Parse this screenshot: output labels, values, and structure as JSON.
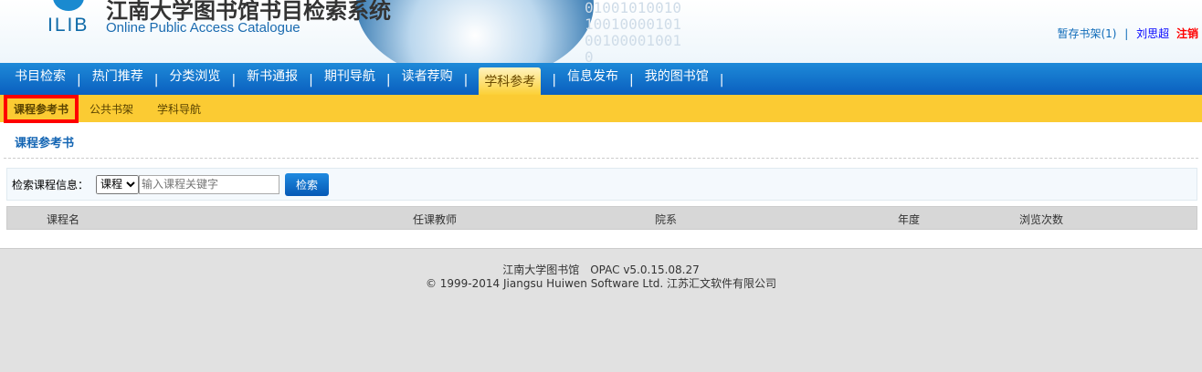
{
  "header": {
    "logo": "ILIB",
    "title": "江南大学图书馆书目检索系统",
    "subtitle": "Online Public Access Catalogue",
    "digits": "0100101001010010000101001000010010"
  },
  "userbar": {
    "shelf": "暂存书架(1)",
    "sep": "|",
    "user": "刘思超",
    "logout": "注销"
  },
  "nav": [
    "书目检索",
    "热门推荐",
    "分类浏览",
    "新书通报",
    "期刊导航",
    "读者荐购",
    "学科参考",
    "信息发布",
    "我的图书馆"
  ],
  "nav_active": 6,
  "subnav": [
    "课程参考书",
    "公共书架",
    "学科导航"
  ],
  "page_title": "课程参考书",
  "search": {
    "label": "检索课程信息：",
    "select": "课程",
    "placeholder": "输入课程关键字",
    "button": "检索"
  },
  "table": {
    "headers": [
      "课程名",
      "任课教师",
      "院系",
      "年度",
      "浏览次数"
    ]
  },
  "footer": {
    "line1": "江南大学图书馆　OPAC v5.0.15.08.27",
    "line2": "© 1999-2014 Jiangsu Huiwen Software Ltd. 江苏汇文软件有限公司"
  }
}
